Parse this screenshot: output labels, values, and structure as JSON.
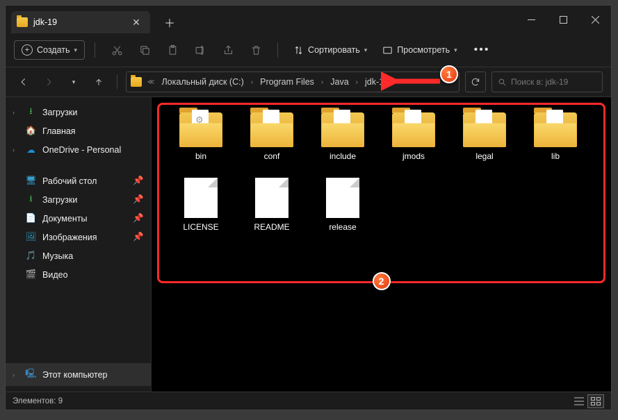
{
  "tab": {
    "title": "jdk-19"
  },
  "toolbar": {
    "create": "Создать",
    "sort": "Сортировать",
    "view": "Просмотреть"
  },
  "breadcrumb": {
    "parts": [
      "Локальный диск (C:)",
      "Program Files",
      "Java",
      "jdk-19"
    ]
  },
  "search": {
    "placeholder": "Поиск в: jdk-19"
  },
  "sidebar": {
    "downloads": "Загрузки",
    "home": "Главная",
    "onedrive": "OneDrive - Personal",
    "desktop": "Рабочий стол",
    "downloads2": "Загрузки",
    "documents": "Документы",
    "pictures": "Изображения",
    "music": "Музыка",
    "videos": "Видео",
    "thispc": "Этот компьютер"
  },
  "items": [
    {
      "name": "bin",
      "type": "folder",
      "gear": true
    },
    {
      "name": "conf",
      "type": "folder"
    },
    {
      "name": "include",
      "type": "folder"
    },
    {
      "name": "jmods",
      "type": "folder"
    },
    {
      "name": "legal",
      "type": "folder"
    },
    {
      "name": "lib",
      "type": "folder"
    },
    {
      "name": "LICENSE",
      "type": "file"
    },
    {
      "name": "README",
      "type": "file"
    },
    {
      "name": "release",
      "type": "file"
    }
  ],
  "status": {
    "count_label": "Элементов:",
    "count": "9"
  },
  "annotations": {
    "b1": "1",
    "b2": "2"
  }
}
